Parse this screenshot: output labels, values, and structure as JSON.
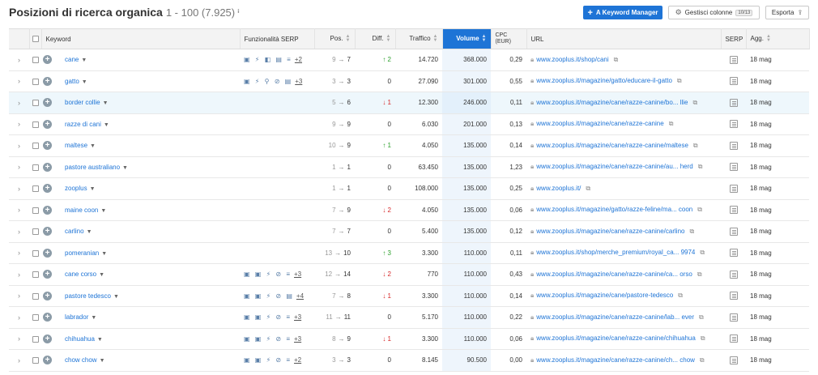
{
  "header": {
    "title": "Posizioni di ricerca organica",
    "count": "1 - 100 (7.925)",
    "info_icon": "ⁱ",
    "keyword_manager": "A Keyword Manager",
    "manage_columns": "Gestisci colonne",
    "columns_badge": "10/13",
    "export": "Esporta"
  },
  "columns": {
    "keyword": "Keyword",
    "serp_features": "Funzionalità SERP",
    "pos": "Pos.",
    "diff": "Diff.",
    "traffic": "Traffico",
    "volume": "Volume",
    "cpc": "CPC (EUR)",
    "url": "URL",
    "serp": "SERP",
    "updated": "Agg."
  },
  "rows": [
    {
      "keyword": "cane",
      "features": "▣ ⚡ ◧ ▤ ≡",
      "more": "+2",
      "pos_prev": "9",
      "pos_cur": "7",
      "diff": "↑ 2",
      "diff_dir": "up",
      "traffic": "14.720",
      "volume": "368.000",
      "cpc": "0,29",
      "url": "www.zooplus.it/shop/cani",
      "updated": "18 mag"
    },
    {
      "keyword": "gatto",
      "features": "▣ ⚡ ⚲ ⊘ ▤",
      "more": "+3",
      "pos_prev": "3",
      "pos_cur": "3",
      "diff": "0",
      "diff_dir": "none",
      "traffic": "27.090",
      "volume": "301.000",
      "cpc": "0,55",
      "url": "www.zooplus.it/magazine/gatto/educare-il-gatto",
      "updated": "18 mag"
    },
    {
      "keyword": "border collie",
      "features": "",
      "more": "",
      "pos_prev": "5",
      "pos_cur": "6",
      "diff": "↓ 1",
      "diff_dir": "down",
      "traffic": "12.300",
      "volume": "246.000",
      "cpc": "0,11",
      "url": "www.zooplus.it/magazine/cane/razze-canine/bo... llie",
      "updated": "18 mag"
    },
    {
      "keyword": "razze di cani",
      "features": "",
      "more": "",
      "pos_prev": "9",
      "pos_cur": "9",
      "diff": "0",
      "diff_dir": "none",
      "traffic": "6.030",
      "volume": "201.000",
      "cpc": "0,13",
      "url": "www.zooplus.it/magazine/cane/razze-canine",
      "updated": "18 mag"
    },
    {
      "keyword": "maltese",
      "features": "",
      "more": "",
      "pos_prev": "10",
      "pos_cur": "9",
      "diff": "↑ 1",
      "diff_dir": "up",
      "traffic": "4.050",
      "volume": "135.000",
      "cpc": "0,14",
      "url": "www.zooplus.it/magazine/cane/razze-canine/maltese",
      "updated": "18 mag"
    },
    {
      "keyword": "pastore australiano",
      "features": "",
      "more": "",
      "pos_prev": "1",
      "pos_cur": "1",
      "diff": "0",
      "diff_dir": "none",
      "traffic": "63.450",
      "volume": "135.000",
      "cpc": "1,23",
      "url": "www.zooplus.it/magazine/cane/razze-canine/au... herd",
      "updated": "18 mag"
    },
    {
      "keyword": "zooplus",
      "features": "",
      "more": "",
      "pos_prev": "1",
      "pos_cur": "1",
      "diff": "0",
      "diff_dir": "none",
      "traffic": "108.000",
      "volume": "135.000",
      "cpc": "0,25",
      "url": "www.zooplus.it/",
      "updated": "18 mag"
    },
    {
      "keyword": "maine coon",
      "features": "",
      "more": "",
      "pos_prev": "7",
      "pos_cur": "9",
      "diff": "↓ 2",
      "diff_dir": "down",
      "traffic": "4.050",
      "volume": "135.000",
      "cpc": "0,06",
      "url": "www.zooplus.it/magazine/gatto/razze-feline/ma... coon",
      "updated": "18 mag"
    },
    {
      "keyword": "carlino",
      "features": "",
      "more": "",
      "pos_prev": "7",
      "pos_cur": "7",
      "diff": "0",
      "diff_dir": "none",
      "traffic": "5.400",
      "volume": "135.000",
      "cpc": "0,12",
      "url": "www.zooplus.it/magazine/cane/razze-canine/carlino",
      "updated": "18 mag"
    },
    {
      "keyword": "pomeranian",
      "features": "",
      "more": "",
      "pos_prev": "13",
      "pos_cur": "10",
      "diff": "↑ 3",
      "diff_dir": "up",
      "traffic": "3.300",
      "volume": "110.000",
      "cpc": "0,11",
      "url": "www.zooplus.it/shop/merche_premium/royal_ca... 9974",
      "updated": "18 mag"
    },
    {
      "keyword": "cane corso",
      "features": "▣ ▣ ⚡ ⊘ ≡",
      "more": "+3",
      "pos_prev": "12",
      "pos_cur": "14",
      "diff": "↓ 2",
      "diff_dir": "down",
      "traffic": "770",
      "volume": "110.000",
      "cpc": "0,43",
      "url": "www.zooplus.it/magazine/cane/razze-canine/ca... orso",
      "updated": "18 mag"
    },
    {
      "keyword": "pastore tedesco",
      "features": "▣ ▣ ⚡ ⊘ ▤",
      "more": "+4",
      "pos_prev": "7",
      "pos_cur": "8",
      "diff": "↓ 1",
      "diff_dir": "down",
      "traffic": "3.300",
      "volume": "110.000",
      "cpc": "0,14",
      "url": "www.zooplus.it/magazine/cane/pastore-tedesco",
      "updated": "18 mag"
    },
    {
      "keyword": "labrador",
      "features": "▣ ▣ ⚡ ⊘ ≡",
      "more": "+3",
      "pos_prev": "11",
      "pos_cur": "11",
      "diff": "0",
      "diff_dir": "none",
      "traffic": "5.170",
      "volume": "110.000",
      "cpc": "0,22",
      "url": "www.zooplus.it/magazine/cane/razze-canine/lab... ever",
      "updated": "18 mag"
    },
    {
      "keyword": "chihuahua",
      "features": "▣ ▣ ⚡ ⊘ ≡",
      "more": "+3",
      "pos_prev": "8",
      "pos_cur": "9",
      "diff": "↓ 1",
      "diff_dir": "down",
      "traffic": "3.300",
      "volume": "110.000",
      "cpc": "0,06",
      "url": "www.zooplus.it/magazine/cane/razze-canine/chihuahua",
      "updated": "18 mag"
    },
    {
      "keyword": "chow chow",
      "features": "▣ ▣ ⚡ ⊘ ≡",
      "more": "+2",
      "pos_prev": "3",
      "pos_cur": "3",
      "diff": "0",
      "diff_dir": "none",
      "traffic": "8.145",
      "volume": "90.500",
      "cpc": "0,00",
      "url": "www.zooplus.it/magazine/cane/razze-canine/ch... chow",
      "updated": "18 mag"
    }
  ]
}
